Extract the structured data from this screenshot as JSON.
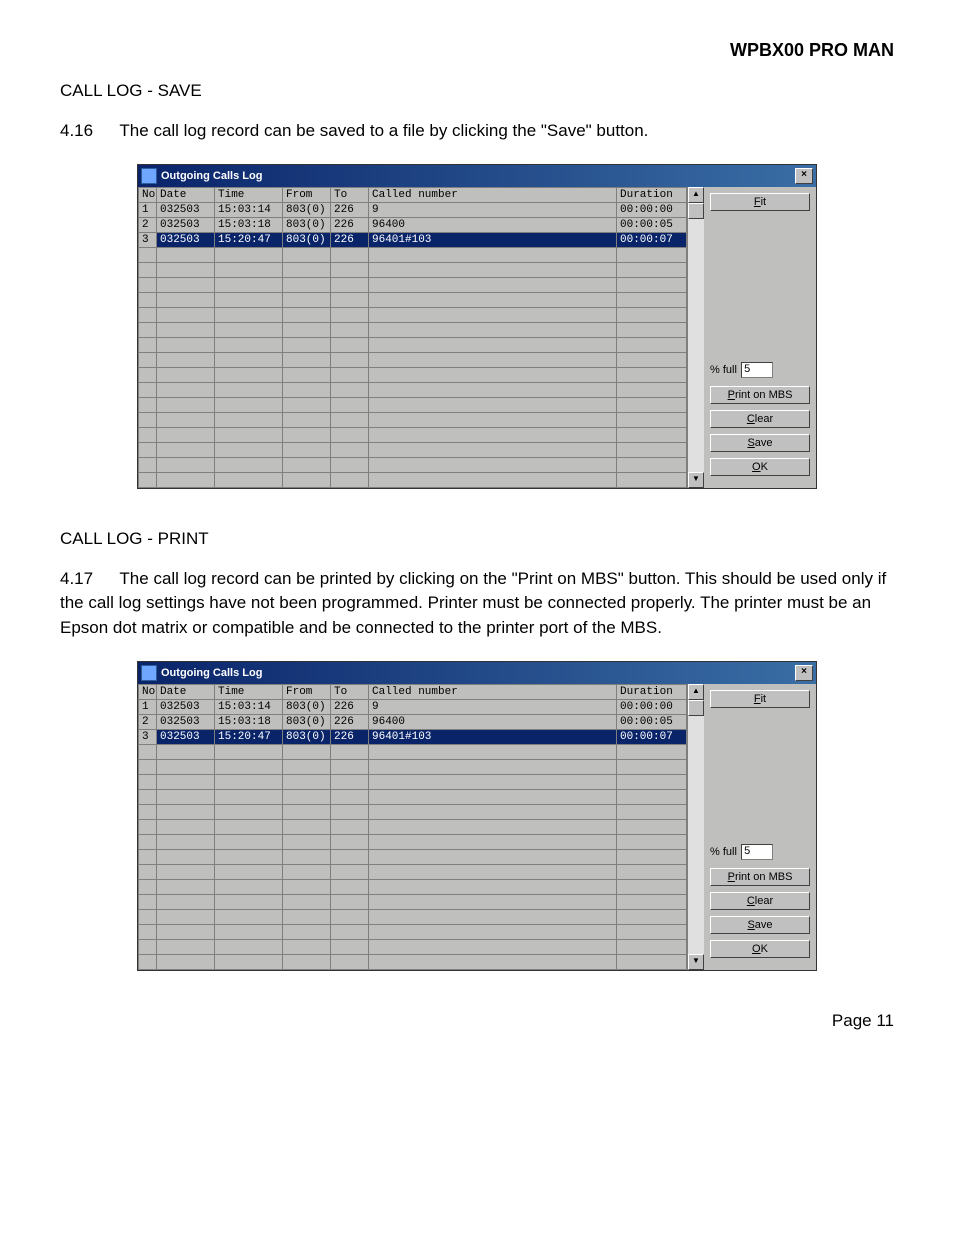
{
  "header": "WPBX00 PRO MAN",
  "section_save": {
    "title": "CALL LOG - SAVE",
    "num": "4.16",
    "text": "The call log record can be saved to a file by clicking the \"Save\" button."
  },
  "section_print": {
    "title": "CALL LOG - PRINT",
    "num": "4.17",
    "text": "The call log record can be printed by clicking on the \"Print on MBS\" button.  This should be used only if the call log settings have not been programmed.  Printer must be connected properly.  The printer must be an Epson dot matrix or compatible and be connected to the printer port of the MBS."
  },
  "page": "Page 11",
  "dialog": {
    "title": "Outgoing Calls Log",
    "columns": {
      "no": "No",
      "date": "Date",
      "time": "Time",
      "from": "From",
      "to": "To",
      "called": "Called number",
      "dur": "Duration"
    },
    "rows": [
      {
        "no": "1",
        "date": "032503",
        "time": "15:03:14",
        "from": "803(0)",
        "to": "226",
        "called": "9",
        "dur": "00:00:00"
      },
      {
        "no": "2",
        "date": "032503",
        "time": "15:03:18",
        "from": "803(0)",
        "to": "226",
        "called": "96400",
        "dur": "00:00:05"
      },
      {
        "no": "3",
        "date": "032503",
        "time": "15:20:47",
        "from": "803(0)",
        "to": "226",
        "called": "96401#103",
        "dur": "00:00:07"
      }
    ],
    "buttons": {
      "fit": "Fit",
      "pct_label": "% full",
      "pct_value": "5",
      "print": "Print on MBS",
      "clear": "Clear",
      "save": "Save",
      "ok": "OK"
    }
  }
}
